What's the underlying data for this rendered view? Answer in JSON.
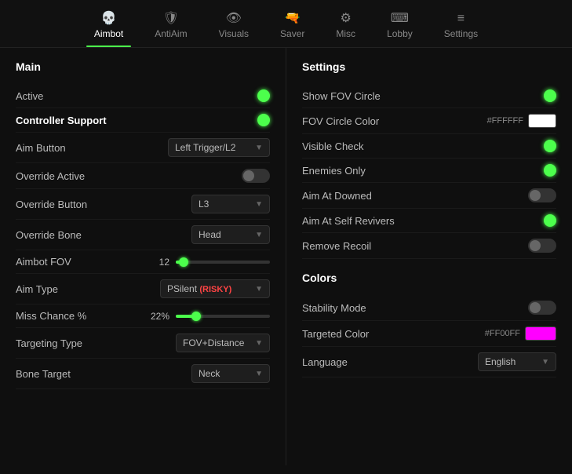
{
  "nav": {
    "items": [
      {
        "id": "aimbot",
        "label": "Aimbot",
        "icon": "💀",
        "active": true
      },
      {
        "id": "antiaim",
        "label": "AntiAim",
        "icon": "🛡",
        "active": false
      },
      {
        "id": "visuals",
        "label": "Visuals",
        "icon": "👁",
        "active": false
      },
      {
        "id": "saver",
        "label": "Saver",
        "icon": "🔫",
        "active": false
      },
      {
        "id": "misc",
        "label": "Misc",
        "icon": "⚙",
        "active": false
      },
      {
        "id": "lobby",
        "label": "Lobby",
        "icon": "⌨",
        "active": false
      },
      {
        "id": "settings",
        "label": "Settings",
        "icon": "≡",
        "active": false
      }
    ]
  },
  "left": {
    "section": "Main",
    "rows": [
      {
        "id": "active",
        "label": "Active",
        "bold": false,
        "control": "green-dot"
      },
      {
        "id": "controller-support",
        "label": "Controller Support",
        "bold": true,
        "control": "green-dot"
      },
      {
        "id": "aim-button",
        "label": "Aim Button",
        "bold": false,
        "control": "dropdown",
        "value": "Left Trigger/L2"
      },
      {
        "id": "override-active",
        "label": "Override Active",
        "bold": false,
        "control": "toggle-off"
      },
      {
        "id": "override-button",
        "label": "Override Button",
        "bold": false,
        "control": "dropdown",
        "value": "L3"
      },
      {
        "id": "override-bone",
        "label": "Override Bone",
        "bold": false,
        "control": "dropdown",
        "value": "Head"
      },
      {
        "id": "aimbot-fov",
        "label": "Aimbot FOV",
        "bold": false,
        "control": "slider",
        "value": "12",
        "percent": 8
      },
      {
        "id": "aim-type",
        "label": "Aim Type",
        "bold": false,
        "control": "dropdown-risky",
        "value": "PSilent (RISKY)"
      },
      {
        "id": "miss-chance",
        "label": "Miss Chance %",
        "bold": false,
        "control": "slider",
        "value": "22%",
        "percent": 20
      },
      {
        "id": "targeting-type",
        "label": "Targeting Type",
        "bold": false,
        "control": "dropdown",
        "value": "FOV+Distance"
      },
      {
        "id": "bone-target",
        "label": "Bone Target",
        "bold": false,
        "control": "dropdown",
        "value": "Neck"
      }
    ]
  },
  "right": {
    "section1": "Settings",
    "settings_rows": [
      {
        "id": "show-fov-circle",
        "label": "Show FOV Circle",
        "control": "green-dot"
      },
      {
        "id": "fov-circle-color",
        "label": "FOV Circle Color",
        "control": "color",
        "value": "#FFFFFF",
        "color": "#ffffff"
      },
      {
        "id": "visible-check",
        "label": "Visible Check",
        "control": "green-dot"
      },
      {
        "id": "enemies-only",
        "label": "Enemies Only",
        "control": "green-dot"
      },
      {
        "id": "aim-at-downed",
        "label": "Aim At Downed",
        "control": "toggle-off"
      },
      {
        "id": "aim-at-self-revivers",
        "label": "Aim At Self Revivers",
        "control": "green-dot"
      },
      {
        "id": "remove-recoil",
        "label": "Remove Recoil",
        "control": "toggle-off"
      }
    ],
    "section2": "Colors",
    "colors_rows": [
      {
        "id": "stability-mode",
        "label": "Stability Mode",
        "control": "toggle-off"
      },
      {
        "id": "targeted-color",
        "label": "Targeted Color",
        "control": "color",
        "value": "#FF00FF",
        "color": "#ff00ff"
      },
      {
        "id": "language",
        "label": "Language",
        "control": "dropdown",
        "value": "English"
      }
    ]
  }
}
